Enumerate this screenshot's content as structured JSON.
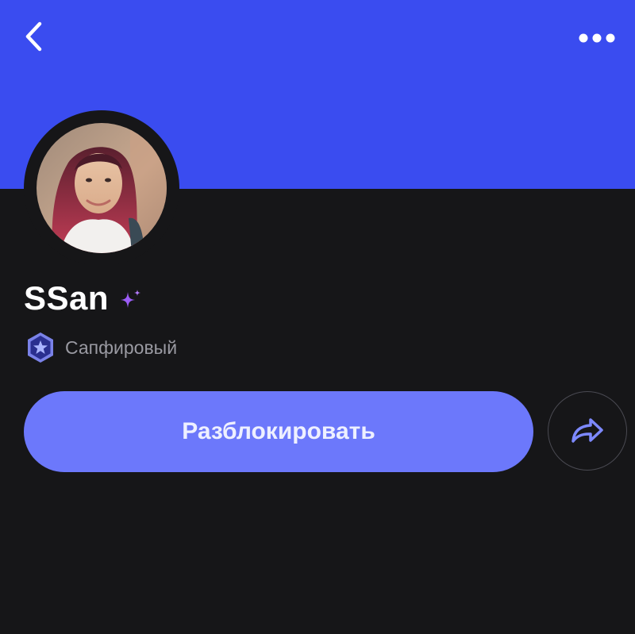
{
  "header": {
    "back_icon": "chevron-left-icon",
    "more_icon": "more-horizontal-icon",
    "cover_color": "#3a4cf0"
  },
  "profile": {
    "name": "SSan",
    "name_badge_icon": "sparkle-icon",
    "tier_icon": "sapphire-star-badge-icon",
    "tier_label": "Сапфировый"
  },
  "actions": {
    "unlock_label": "Разблокировать",
    "unlock_color": "#6c78fb",
    "share_icon": "share-arrow-icon"
  }
}
